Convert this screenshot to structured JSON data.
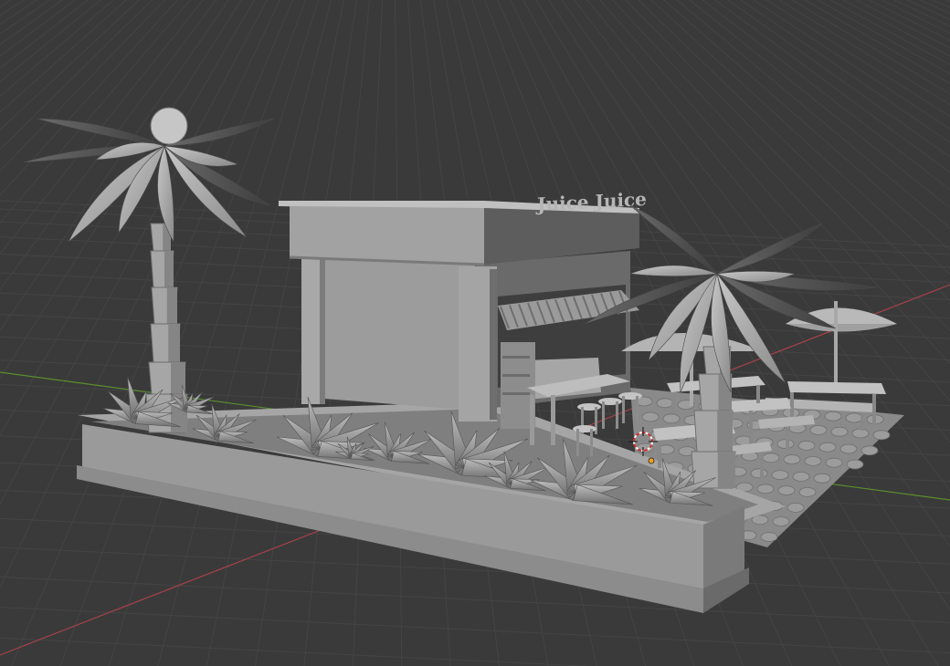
{
  "viewport": {
    "background": "#3a3a3a",
    "grid_color": "#454545",
    "x_axis_color": "#b4444c",
    "y_axis_color": "#5e9a2c"
  },
  "model": {
    "sign_text": "Juice Juice",
    "base_color": "#9a9a9a",
    "light_color": "#b8b8b8",
    "dark_color": "#5c5c5c"
  },
  "cursor": {
    "name": "3d-cursor",
    "origin_color": "#f0a020"
  }
}
